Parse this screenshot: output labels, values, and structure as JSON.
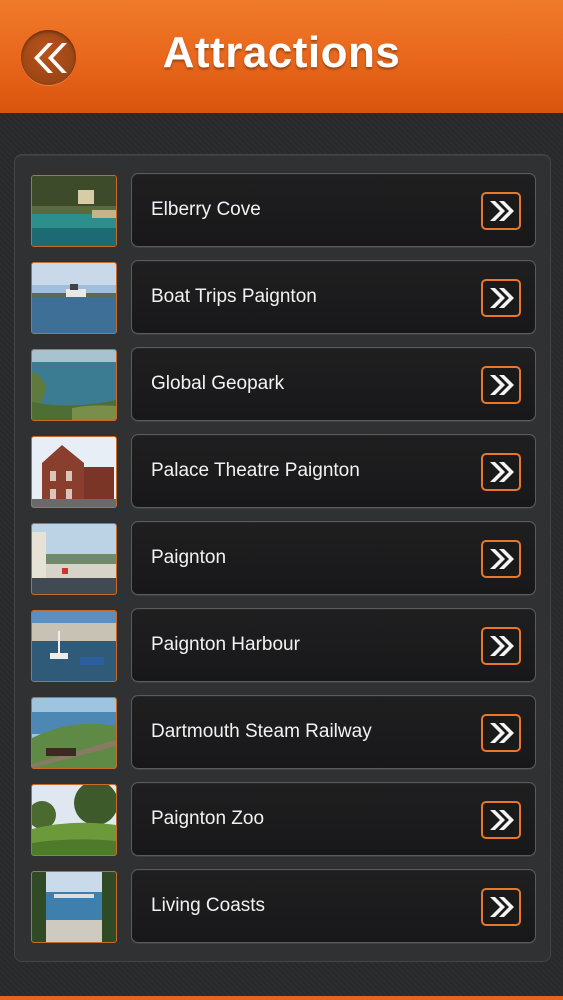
{
  "header": {
    "title": "Attractions",
    "back_icon": "double-chevron-left-icon",
    "accent_color": "#e8661b"
  },
  "items": [
    {
      "label": "Elberry Cove",
      "thumb": "cove"
    },
    {
      "label": "Boat Trips Paignton",
      "thumb": "boat"
    },
    {
      "label": "Global Geopark",
      "thumb": "coast"
    },
    {
      "label": "Palace Theatre Paignton",
      "thumb": "building"
    },
    {
      "label": "Paignton",
      "thumb": "town"
    },
    {
      "label": "Paignton Harbour",
      "thumb": "harbour"
    },
    {
      "label": "Dartmouth Steam Railway",
      "thumb": "railway"
    },
    {
      "label": "Paignton Zoo",
      "thumb": "park"
    },
    {
      "label": "Living Coasts",
      "thumb": "bay"
    }
  ],
  "item_button_icon": "double-chevron-right-icon"
}
